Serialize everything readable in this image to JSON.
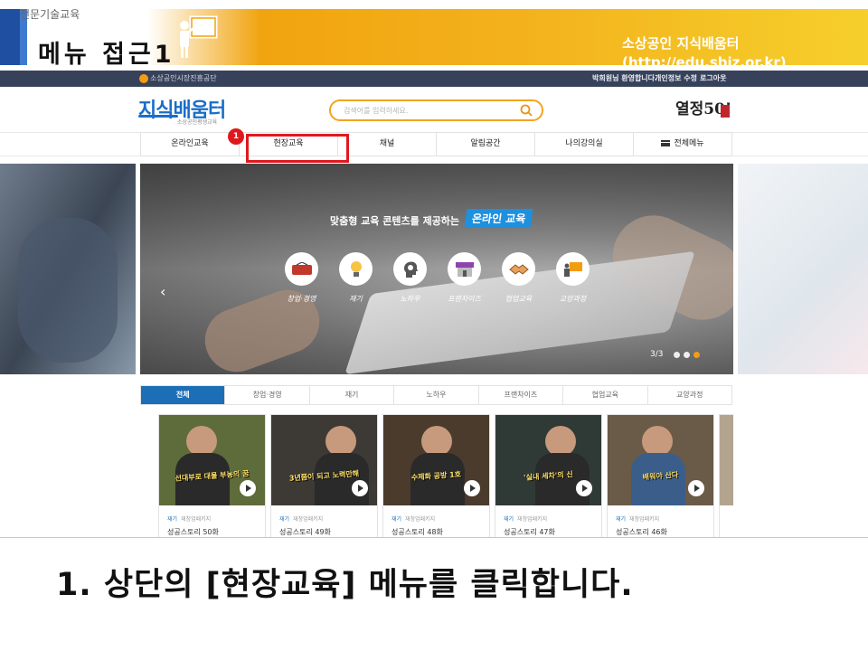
{
  "slide": {
    "sup_label": "전문기술교육",
    "title": "메뉴   접근1",
    "right_text": "소상공인 지식배움터(http://edu.sbiz.or.kr)",
    "instruction": "1. 상단의 [현장교육] 메뉴를 클릭합니다."
  },
  "site": {
    "topbar": {
      "brand": "소상공인시장진흥공단",
      "welcome": "박희원님 환영합니다.",
      "edit_profile": "개인정보 수정",
      "logout": "로그아웃"
    },
    "logo": {
      "name": "지식배움터",
      "subtitle": "소상공인평생교육"
    },
    "search": {
      "placeholder": "검색어를 입력하세요."
    },
    "slogan": "열정50!",
    "nav": [
      {
        "label": "온라인교육"
      },
      {
        "label": "현장교육"
      },
      {
        "label": "채널"
      },
      {
        "label": "알림공간"
      },
      {
        "label": "나의강의실"
      },
      {
        "label": "전체메뉴"
      }
    ],
    "highlight_badge": "1",
    "banner": {
      "lead": "맞춤형 교육 콘텐츠를 제공하는",
      "tag": "온라인 교육",
      "icons": [
        {
          "label": "창업·경영",
          "icon": "open-sign-icon"
        },
        {
          "label": "재기",
          "icon": "lightbulb-icon"
        },
        {
          "label": "노하우",
          "icon": "head-gear-icon"
        },
        {
          "label": "프랜차이즈",
          "icon": "storefront-icon"
        },
        {
          "label": "협업교육",
          "icon": "handshake-icon"
        },
        {
          "label": "교양과정",
          "icon": "presentation-icon"
        }
      ],
      "page": "3/3"
    },
    "tabs": [
      "전체",
      "창업·경영",
      "재기",
      "노하우",
      "프랜차이즈",
      "협업교육",
      "교양과정"
    ],
    "cards": [
      {
        "caption": "선대부로 대물 부농의 꿈",
        "cat": "재기",
        "sub": "재창업패키지",
        "title": "성공스토리 50화",
        "bg": "#5e6b3a"
      },
      {
        "caption": "3년쯤이 되고 노력만해",
        "cat": "재기",
        "sub": "재창업패키지",
        "title": "성공스토리 49화",
        "bg": "#3d3a35"
      },
      {
        "caption": "수제화 공방 1호",
        "cat": "재기",
        "sub": "재창업패키지",
        "title": "성공스토리 48화",
        "bg": "#4a3b2c"
      },
      {
        "caption": "'실내 세차'의 신",
        "cat": "재기",
        "sub": "재창업패키지",
        "title": "성공스토리 47화",
        "bg": "#2f3a36"
      },
      {
        "caption": "배워야 산다",
        "cat": "재기",
        "sub": "재창업패키지",
        "title": "성공스토리 46화",
        "bg": "#6a5a48"
      }
    ]
  }
}
